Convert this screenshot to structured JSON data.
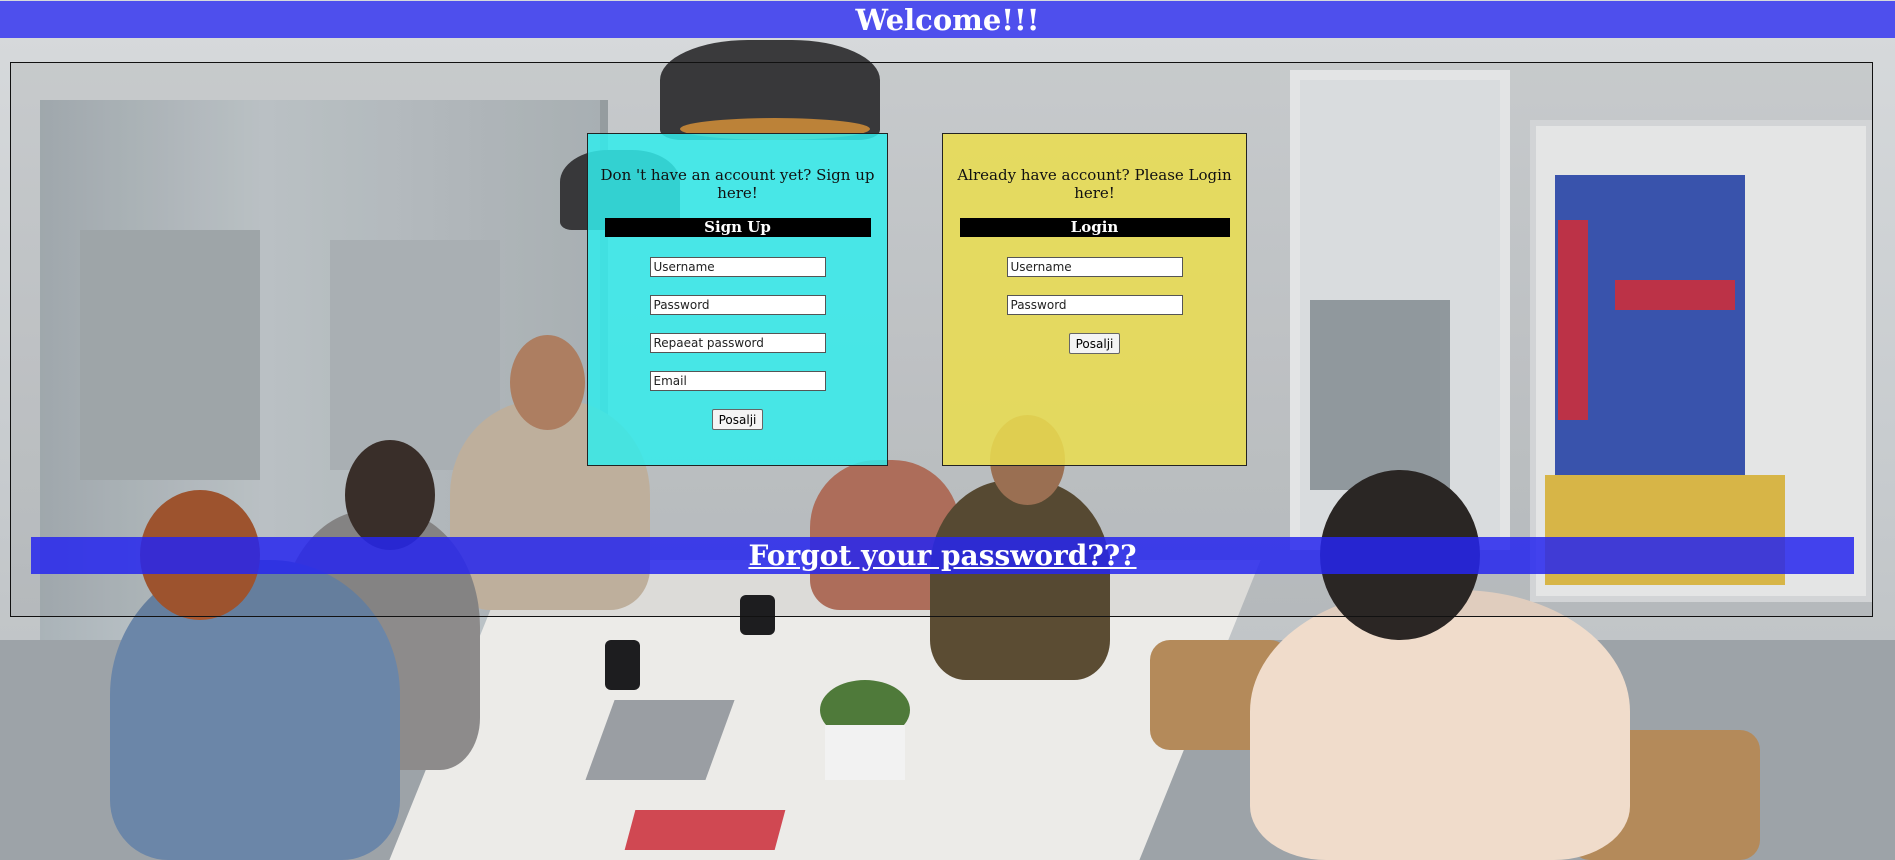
{
  "header": {
    "title": "Welcome!!!"
  },
  "signup": {
    "prompt": "Don 't have an account yet? Sign up here!",
    "heading": "Sign Up",
    "username_placeholder": "Username",
    "password_placeholder": "Password",
    "repeat_password_placeholder": "Repaeat password",
    "email_placeholder": "Email",
    "submit_label": "Posalji"
  },
  "login": {
    "prompt": "Already have account? Please Login here!",
    "heading": "Login",
    "username_placeholder": "Username",
    "password_placeholder": "Password",
    "submit_label": "Posalji"
  },
  "forgot": {
    "link_text": "Forgot your password???"
  },
  "colors": {
    "header_bg": "#3636f0",
    "signup_bg": "#32ecec",
    "login_bg": "#e9dc50",
    "forgot_bg": "#2626ee"
  },
  "background": {
    "icon": "office-meeting-photo"
  }
}
